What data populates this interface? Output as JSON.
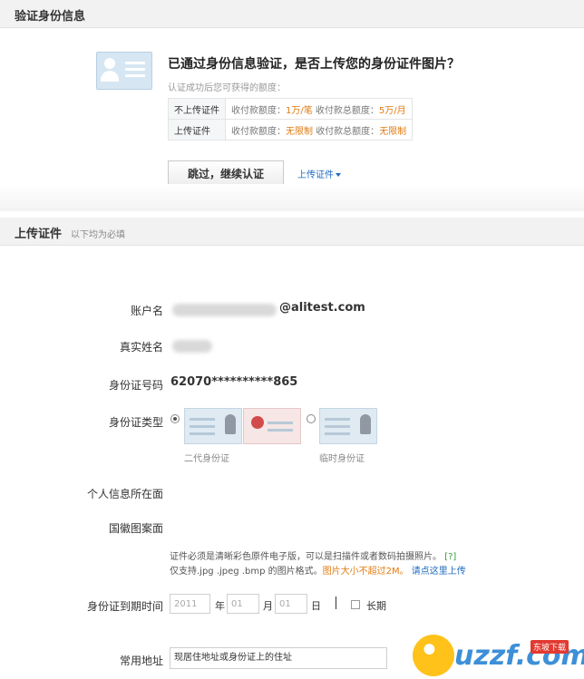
{
  "verify_section": {
    "title": "验证身份信息"
  },
  "verify": {
    "question": "已通过身份信息验证，是否上传您的身份证件图片？",
    "hint": "认证成功后您可获得的额度：",
    "limits": [
      {
        "label": "不上传证件",
        "single_label": "收付款额度：",
        "single_value": "1万/笔",
        "total_label": "收付款总额度：",
        "total_value": "5万/月"
      },
      {
        "label": "上传证件",
        "single_label": "收付款额度：",
        "single_value": "无限制",
        "total_label": "收付款总额度：",
        "total_value": "无限制"
      }
    ],
    "skip_button": "跳过，继续认证",
    "upload_link": "上传证件"
  },
  "upload_section": {
    "title": "上传证件",
    "subtitle": "以下均为必填"
  },
  "form": {
    "account_label": "账户名",
    "account_value": "@alitest.com",
    "realname_label": "真实姓名",
    "idnum_label": "身份证号码",
    "idnum_value": "62070**********865",
    "idtype_label": "身份证类型",
    "idtype_options": [
      {
        "caption": "二代身份证",
        "selected": true
      },
      {
        "caption": "临时身份证",
        "selected": false
      }
    ],
    "front_label": "个人信息所在面",
    "back_label": "国徽图案面",
    "notice_line1": "证件必须是清晰彩色原件电子版，可以是扫描件或者数码拍摄照片。",
    "notice_help": "[?]",
    "notice_line2": "仅支持.jpg .jpeg .bmp 的图片格式。",
    "notice_size": "图片大小不超过2M。",
    "notice_link": "请点这里上传",
    "expiry_label": "身份证到期时间",
    "expiry_year": "2011",
    "expiry_year_unit": "年",
    "expiry_month": "01",
    "expiry_month_unit": "月",
    "expiry_day": "01",
    "expiry_day_unit": "日",
    "longterm_label": "长期",
    "address_label": "常用地址",
    "address_value": "现居住地址或身份证上的住址"
  },
  "watermark": {
    "text": "uzzf.com",
    "tag": "东坡下载"
  },
  "colors": {
    "accent_link": "#1f6bbf",
    "orange": "#e27b12",
    "header_bg": "#f2f2f2"
  }
}
